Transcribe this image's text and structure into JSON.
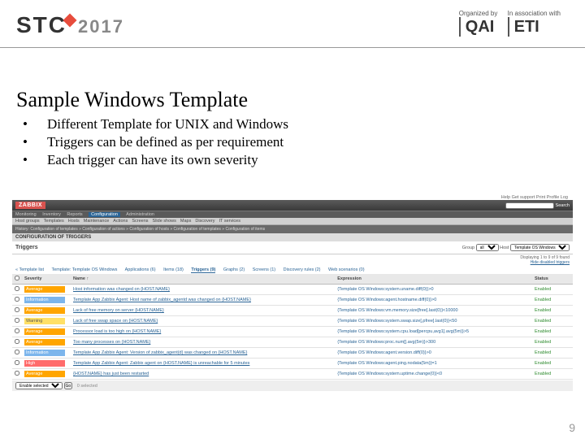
{
  "header": {
    "logo_text": "STC",
    "logo_year": "2017",
    "organized_by_label": "Organized by",
    "organized_by_brand": "QAI",
    "association_label": "In association with",
    "association_brand": "ETI"
  },
  "title": "Sample Windows Template",
  "bullets": [
    "Different Template for UNIX and Windows",
    "Triggers can be defined as per requirement",
    "Each trigger can have its own severity"
  ],
  "zabbix": {
    "top_links": "Help   Get support   Print   Profile   Log",
    "logo": "ZABBIX",
    "main_nav": [
      "Monitoring",
      "Inventory",
      "Reports",
      "Configuration",
      "Administration"
    ],
    "main_nav_selected": "Configuration",
    "sub_nav": [
      "Host groups",
      "Templates",
      "Hosts",
      "Maintenance",
      "Actions",
      "Screens",
      "Slide shows",
      "Maps",
      "Discovery",
      "IT services"
    ],
    "crumb": "History:  Configuration of templates » Configuration of actions » Configuration of hosts » Configuration of templates » Configuration of items",
    "section": "CONFIGURATION OF TRIGGERS",
    "bar_title": "Triggers",
    "group_label": "Group",
    "group_value": "all",
    "host_label": "Host",
    "host_value": "Template OS Windows",
    "displaying": "Displaying 1 to 9 of 9 found",
    "hide_disabled": "Hide disabled triggers",
    "tabs": {
      "prefix": "« Template list",
      "items": [
        "Template: Template OS Windows",
        "Applications (6)",
        "Items (18)",
        "Triggers (9)",
        "Graphs (2)",
        "Screens (1)",
        "Discovery rules (2)",
        "Web scenarios (0)"
      ]
    },
    "columns": {
      "severity": "Severity",
      "name": "Name ↑",
      "expression": "Expression",
      "status": "Status"
    },
    "rows": [
      {
        "severity": "Average",
        "sev_class": "sev-avg",
        "name": "Host information was changed on {HOST.NAME}",
        "expression": "{Template OS Windows:system.uname.diff(0)}>0",
        "status": "Enabled"
      },
      {
        "severity": "Information",
        "sev_class": "sev-info",
        "name": "Template App Zabbix Agent: Host name of zabbix_agentd was changed on {HOST.NAME}",
        "expression": "{Template OS Windows:agent.hostname.diff(0)}>0",
        "status": "Enabled"
      },
      {
        "severity": "Average",
        "sev_class": "sev-avg",
        "name": "Lack of free memory on server {HOST.NAME}",
        "expression": "{Template OS Windows:vm.memory.size[free].last(0)}<10000",
        "status": "Enabled"
      },
      {
        "severity": "Warning",
        "sev_class": "sev-warn",
        "name": "Lack of free swap space on {HOST.NAME}",
        "expression": "{Template OS Windows:system.swap.size[,pfree].last(0)}<50",
        "status": "Enabled"
      },
      {
        "severity": "Average",
        "sev_class": "sev-avg",
        "name": "Processor load is too high on {HOST.NAME}",
        "expression": "{Template OS Windows:system.cpu.load[percpu,avg1].avg(5m)}>5",
        "status": "Enabled"
      },
      {
        "severity": "Average",
        "sev_class": "sev-avg",
        "name": "Too many processes on {HOST.NAME}",
        "expression": "{Template OS Windows:proc.num[].avg(5m)}>300",
        "status": "Enabled"
      },
      {
        "severity": "Information",
        "sev_class": "sev-info",
        "name": "Template App Zabbix Agent: Version of zabbix_agent(d) was changed on {HOST.NAME}",
        "expression": "{Template OS Windows:agent.version.diff(0)}>0",
        "status": "Enabled"
      },
      {
        "severity": "High",
        "sev_class": "sev-high",
        "name": "Template App Zabbix Agent: Zabbix agent on {HOST.NAME} is unreachable for 5 minutes",
        "expression": "{Template OS Windows:agent.ping.nodata(5m)}=1",
        "status": "Enabled"
      },
      {
        "severity": "Average",
        "sev_class": "sev-avg",
        "name": "{HOST.NAME} has just been restarted",
        "expression": "{Template OS Windows:system.uptime.change(0)}<0",
        "status": "Enabled"
      }
    ],
    "footer_count": "0 selected",
    "footer_action": "Enable selected",
    "footer_go": "Go"
  },
  "page_number": "9"
}
